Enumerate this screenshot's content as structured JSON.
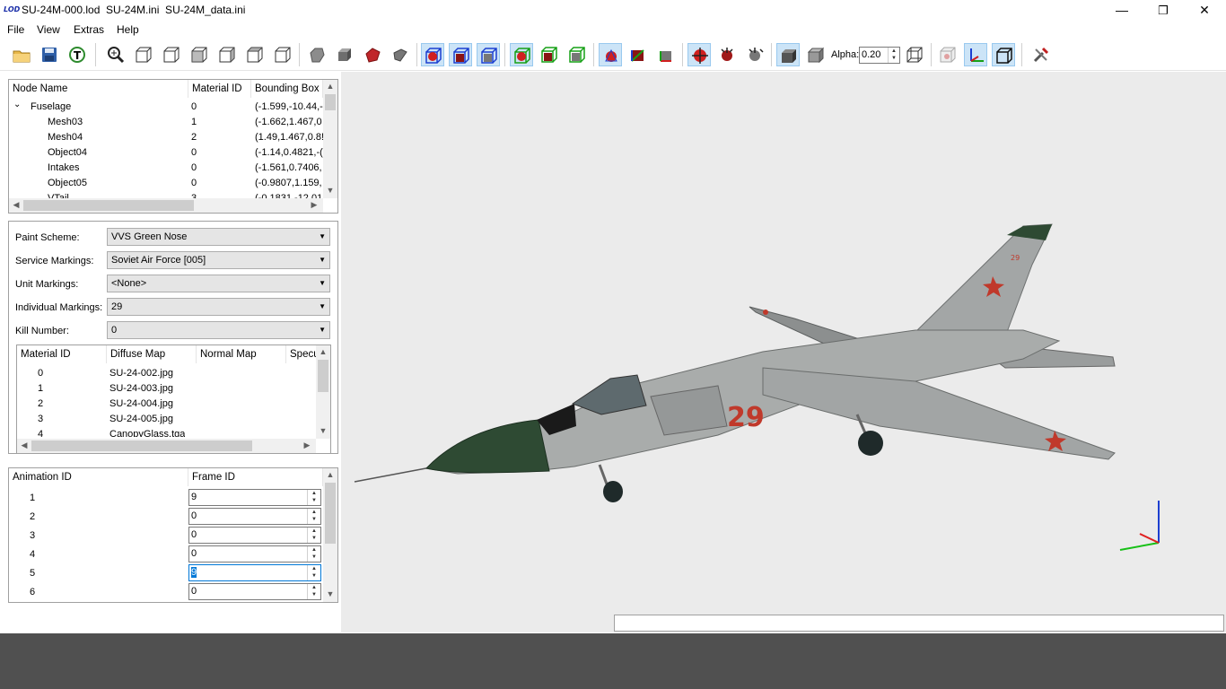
{
  "window": {
    "logo": "LOD",
    "title": "SU-24M-000.lod  SU-24M.ini  SU-24M_data.ini",
    "controls": {
      "minimize": "—",
      "maximize": "❐",
      "close": "✕"
    }
  },
  "menu": {
    "file": "File",
    "view": "View",
    "extras": "Extras",
    "help": "Help"
  },
  "toolbar": {
    "alpha_label": "Alpha:",
    "alpha_value": "0.20"
  },
  "node_tree": {
    "headers": [
      "Node Name",
      "Material ID",
      "Bounding Box"
    ],
    "rows": [
      {
        "name": "Fuselage",
        "material": "0",
        "bbox": "(-1.599,-10.44,-"
      },
      {
        "name": "Mesh03",
        "material": "1",
        "bbox": "(-1.662,1.467,0"
      },
      {
        "name": "Mesh04",
        "material": "2",
        "bbox": "(1.49,1.467,0.8!"
      },
      {
        "name": "Object04",
        "material": "0",
        "bbox": "(-1.14,0.4821,-("
      },
      {
        "name": "Intakes",
        "material": "0",
        "bbox": "(-1.561,0.7406,"
      },
      {
        "name": "Object05",
        "material": "0",
        "bbox": "(-0.9807,1.159,"
      },
      {
        "name": "VTail",
        "material": "3",
        "bbox": "(-0.1831,-12.01"
      }
    ]
  },
  "options": {
    "paint_scheme": {
      "label": "Paint Scheme:",
      "value": "VVS Green Nose"
    },
    "service_markings": {
      "label": "Service Markings:",
      "value": "Soviet Air Force [005]"
    },
    "unit_markings": {
      "label": "Unit Markings:",
      "value": "<None>"
    },
    "individual_markings": {
      "label": "Individual Markings:",
      "value": "29"
    },
    "kill_number": {
      "label": "Kill Number:",
      "value": "0"
    }
  },
  "materials": {
    "headers": [
      "Material ID",
      "Diffuse Map",
      "Normal Map",
      "Specu"
    ],
    "rows": [
      {
        "id": "0",
        "diffuse": "SU-24-002.jpg"
      },
      {
        "id": "1",
        "diffuse": "SU-24-003.jpg"
      },
      {
        "id": "2",
        "diffuse": "SU-24-004.jpg"
      },
      {
        "id": "3",
        "diffuse": "SU-24-005.jpg"
      },
      {
        "id": "4",
        "diffuse": "CanopyGlass.tga"
      }
    ]
  },
  "animations": {
    "headers": [
      "Animation ID",
      "Frame ID"
    ],
    "rows": [
      {
        "id": "1",
        "frame": "9"
      },
      {
        "id": "2",
        "frame": "0"
      },
      {
        "id": "3",
        "frame": "0"
      },
      {
        "id": "4",
        "frame": "0"
      },
      {
        "id": "5",
        "frame": "9"
      },
      {
        "id": "6",
        "frame": "0"
      }
    ]
  },
  "viewport": {
    "aircraft_number": "29",
    "tail_number": "29",
    "colors": {
      "background": "#ebebeb",
      "fuselage": "#a9acab",
      "nose": "#2e4a33",
      "marking": "#c0392b"
    }
  }
}
